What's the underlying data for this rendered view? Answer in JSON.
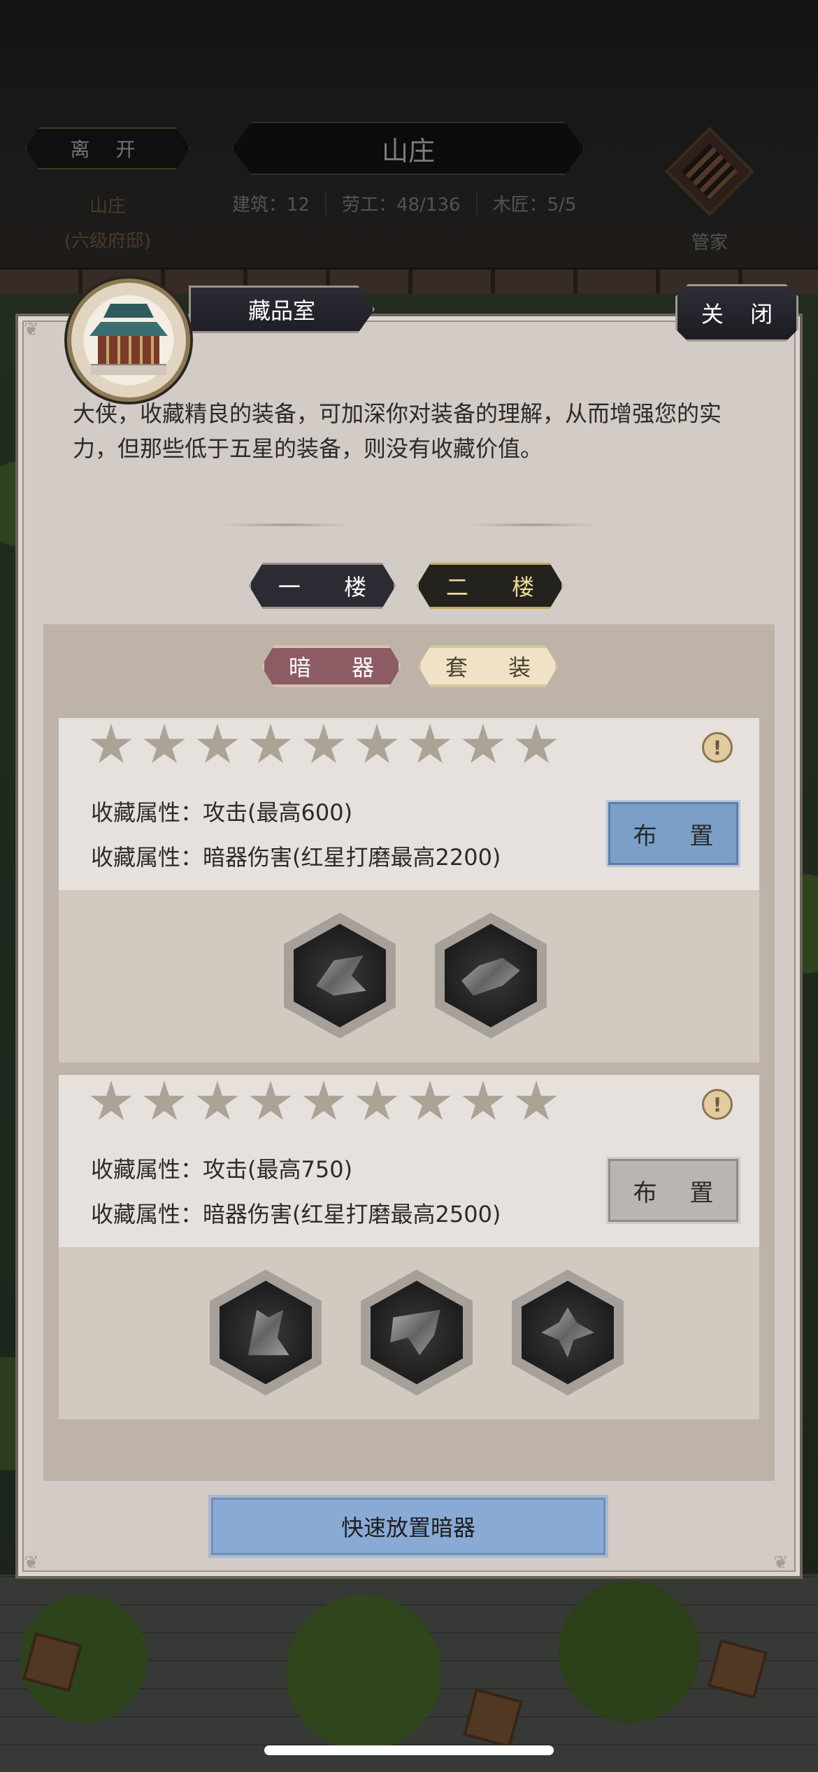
{
  "hud": {
    "leave_label": "离 开",
    "estate_name": "山庄",
    "estate_level": "(六级府邸)",
    "title": "山庄",
    "stats": [
      {
        "label": "建筑：12"
      },
      {
        "label": "劳工：48/136"
      },
      {
        "label": "木匠：5/5"
      }
    ],
    "manager_label": "管家"
  },
  "panel": {
    "title": "藏品室",
    "close_label": "关 闭",
    "description": "大侠，收藏精良的装备，可加深你对装备的理解，从而增强您的实力，但那些低于五星的装备，则没有收藏价值。",
    "floor_tabs": [
      {
        "label": "一 楼",
        "selected": false
      },
      {
        "label": "二 楼",
        "selected": true
      }
    ],
    "type_tabs": [
      {
        "label": "暗 器",
        "selected": true
      },
      {
        "label": "套 装",
        "selected": false
      }
    ],
    "cards": [
      {
        "stars": 9,
        "info_icon": "info-icon",
        "attr1": "收藏属性：攻击(最高600)",
        "attr2": "收藏属性：暗器伤害(红星打磨最高2200)",
        "place_label": "布 置",
        "place_active": true,
        "slots": 2
      },
      {
        "stars": 9,
        "info_icon": "info-icon",
        "attr1": "收藏属性：攻击(最高750)",
        "attr2": "收藏属性：暗器伤害(红星打磨最高2500)",
        "place_label": "布 置",
        "place_active": false,
        "slots": 3
      }
    ],
    "quick_label": "快速放置暗器"
  },
  "colors": {
    "panel_bg": "#d2cbc6",
    "active_tab": "#8c5b64",
    "place_active": "#7b9fc9",
    "place_inactive": "#b9b5b0",
    "star": "#aca397"
  }
}
